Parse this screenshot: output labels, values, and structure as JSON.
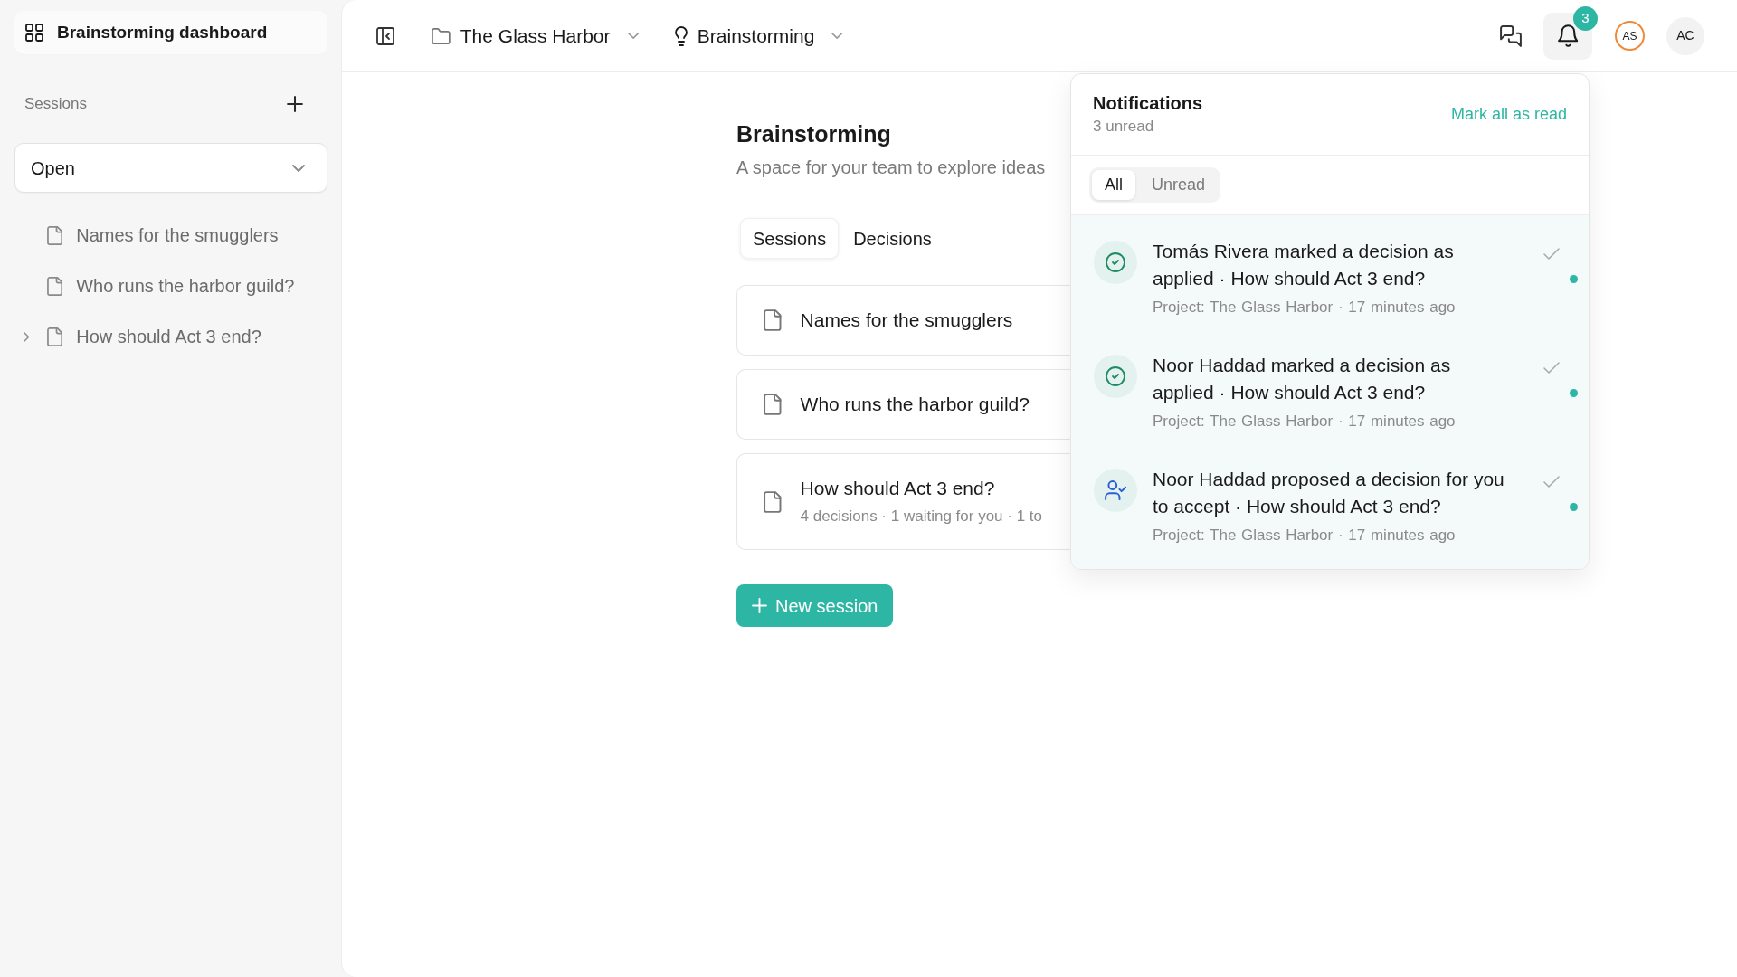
{
  "sidebar": {
    "title": "Brainstorming dashboard",
    "section": {
      "label": "Sessions"
    },
    "filter": {
      "value": "Open"
    },
    "items": [
      {
        "label": "Names for the smugglers",
        "kind": "session"
      },
      {
        "label": "Who runs the harbor guild?",
        "kind": "session"
      },
      {
        "label": "How should Act 3 end?",
        "kind": "group",
        "expanded": false
      }
    ]
  },
  "topbar": {
    "breadcrumbs": [
      {
        "label": "The Glass Harbor",
        "kind": "project"
      },
      {
        "label": "Brainstorming",
        "kind": "space"
      }
    ],
    "notifications_button": {
      "badge": "3",
      "expanded": true
    },
    "avatars": [
      {
        "initials": "AS",
        "kind": "ring"
      },
      {
        "initials": "AC",
        "kind": "plain"
      }
    ]
  },
  "page": {
    "title": "Brainstorming",
    "subtitle": "A space for your team to explore ideas",
    "tabs": [
      {
        "label": "Sessions",
        "selected": true
      },
      {
        "label": "Decisions",
        "selected": false
      }
    ],
    "sessions": [
      {
        "title": "Names for the smugglers"
      },
      {
        "title": "Who runs the harbor guild?"
      },
      {
        "title": "How should Act 3 end?",
        "meta": "4 decisions · 1 waiting for you · 1 to"
      }
    ],
    "new_button": "New session"
  },
  "notifications": {
    "title": "Notifications",
    "count": "3 unread",
    "action": "Mark all as read",
    "filters": [
      {
        "label": "All",
        "selected": true
      },
      {
        "label": "Unread",
        "selected": false
      }
    ],
    "items": [
      {
        "kind": "applied",
        "text": "Tomás Rivera marked a decision as applied · How should Act 3 end?",
        "meta": "Project: The Glass Harbor · 17 minutes ago",
        "unread": true
      },
      {
        "kind": "applied",
        "text": "Noor Haddad marked a decision as applied · How should Act 3 end?",
        "meta": "Project: The Glass Harbor · 17 minutes ago",
        "unread": true
      },
      {
        "kind": "proposed",
        "text": "Noor Haddad proposed a decision for you to accept · How should Act 3 end?",
        "meta": "Project: The Glass Harbor · 17 minutes ago",
        "unread": true
      }
    ]
  }
}
